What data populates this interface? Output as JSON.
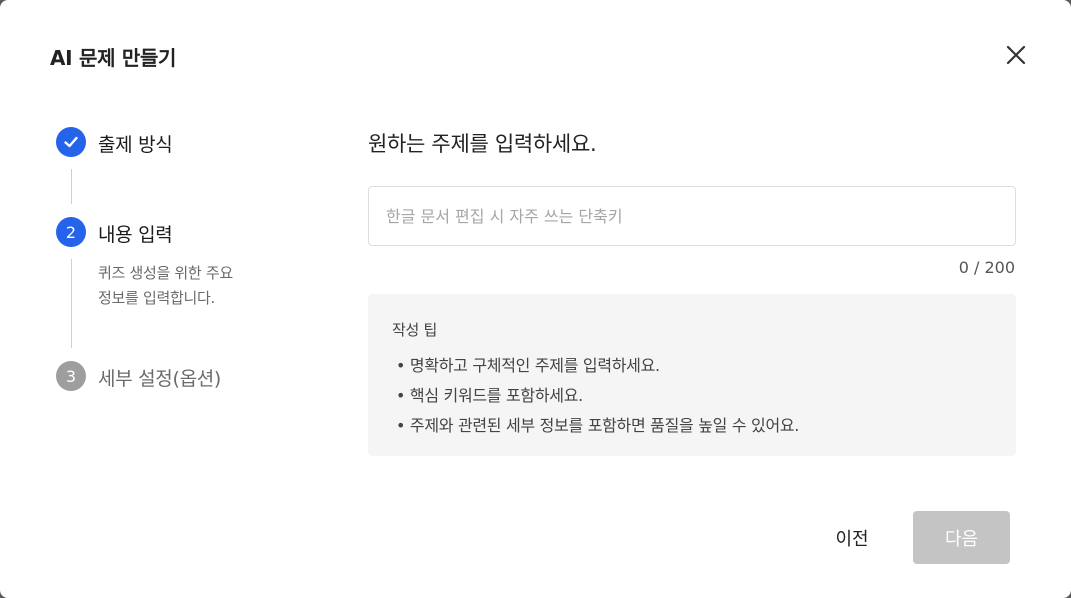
{
  "modal": {
    "title": "AI 문제 만들기",
    "close_icon": "close-icon"
  },
  "stepper": {
    "steps": [
      {
        "number": "1",
        "label": "출제 방식",
        "status": "done",
        "icon": "check-icon"
      },
      {
        "number": "2",
        "label": "내용 입력",
        "status": "active",
        "description_line1": "퀴즈 생성을 위한 주요",
        "description_line2": "정보를 입력합니다."
      },
      {
        "number": "3",
        "label": "세부 설정(옵션)",
        "status": "pending"
      }
    ]
  },
  "main": {
    "prompt": "원하는 주제를 입력하세요.",
    "input": {
      "value": "",
      "placeholder": "한글 문서 편집 시 자주 쓰는 단축키"
    },
    "counter": "0 / 200",
    "tips": {
      "title": "작성 팁",
      "items": [
        "• 명확하고 구체적인 주제를 입력하세요.",
        "• 핵심 키워드를 포함하세요.",
        "• 주제와 관련된 세부 정보를 포함하면 품질을 높일 수 있어요."
      ]
    }
  },
  "footer": {
    "prev_label": "이전",
    "next_label": "다음"
  },
  "colors": {
    "accent": "#2563eb",
    "pending": "#9e9e9e",
    "disabled_button": "#c4c4c4",
    "tips_background": "#f5f5f5"
  }
}
